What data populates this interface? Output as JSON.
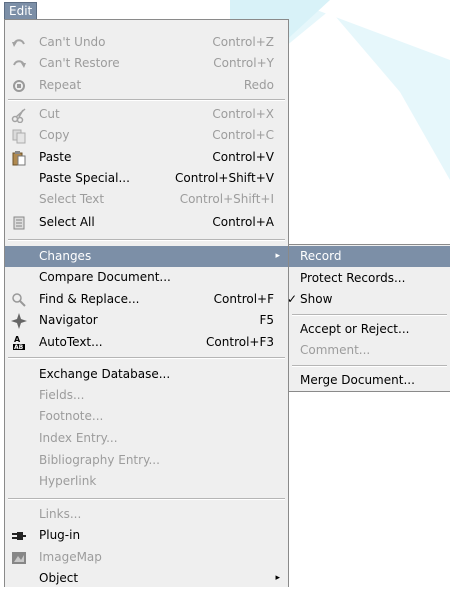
{
  "menubar": {
    "edit_label": "Edit"
  },
  "edit_menu": {
    "items": [
      {
        "label": "Can't Undo",
        "accel": "Control+Z",
        "icon": "undo-icon"
      },
      {
        "label": "Can't Restore",
        "accel": "Control+Y",
        "icon": "redo-icon"
      },
      {
        "label": "Repeat",
        "accel": "Redo",
        "icon": "repeat-icon"
      },
      {
        "label": "Cut",
        "accel": "Control+X",
        "icon": "scissors-icon"
      },
      {
        "label": "Copy",
        "accel": "Control+C",
        "icon": "copy-icon"
      },
      {
        "label": "Paste",
        "accel": "Control+V",
        "icon": "paste-icon"
      },
      {
        "label": "Paste Special...",
        "accel": "Control+Shift+V"
      },
      {
        "label": "Select Text",
        "accel": "Control+Shift+I"
      },
      {
        "label": "Select All",
        "accel": "Control+A",
        "icon": "select-all-icon"
      },
      {
        "label": "Changes"
      },
      {
        "label": "Compare Document..."
      },
      {
        "label": "Find & Replace...",
        "accel": "Control+F",
        "icon": "find-replace-icon"
      },
      {
        "label": "Navigator",
        "accel": "F5",
        "icon": "navigator-icon"
      },
      {
        "label": "AutoText...",
        "accel": "Control+F3",
        "icon": "autotext-icon"
      },
      {
        "label": "Exchange Database..."
      },
      {
        "label": "Fields..."
      },
      {
        "label": "Footnote..."
      },
      {
        "label": "Index Entry..."
      },
      {
        "label": "Bibliography Entry..."
      },
      {
        "label": "Hyperlink"
      },
      {
        "label": "Links..."
      },
      {
        "label": "Plug-in",
        "icon": "plugin-icon"
      },
      {
        "label": "ImageMap",
        "icon": "imagemap-icon"
      },
      {
        "label": "Object"
      }
    ]
  },
  "changes_menu": {
    "items": [
      {
        "label": "Record"
      },
      {
        "label": "Protect Records..."
      },
      {
        "label": "Show",
        "check": "✓"
      },
      {
        "label": "Accept or Reject..."
      },
      {
        "label": "Comment..."
      },
      {
        "label": "Merge Document..."
      }
    ]
  },
  "colors": {
    "highlight": "#7c8fa7",
    "menu_bg": "#efefef",
    "disabled": "#9c9c9c",
    "bg_accent": "#e6f7fb"
  }
}
